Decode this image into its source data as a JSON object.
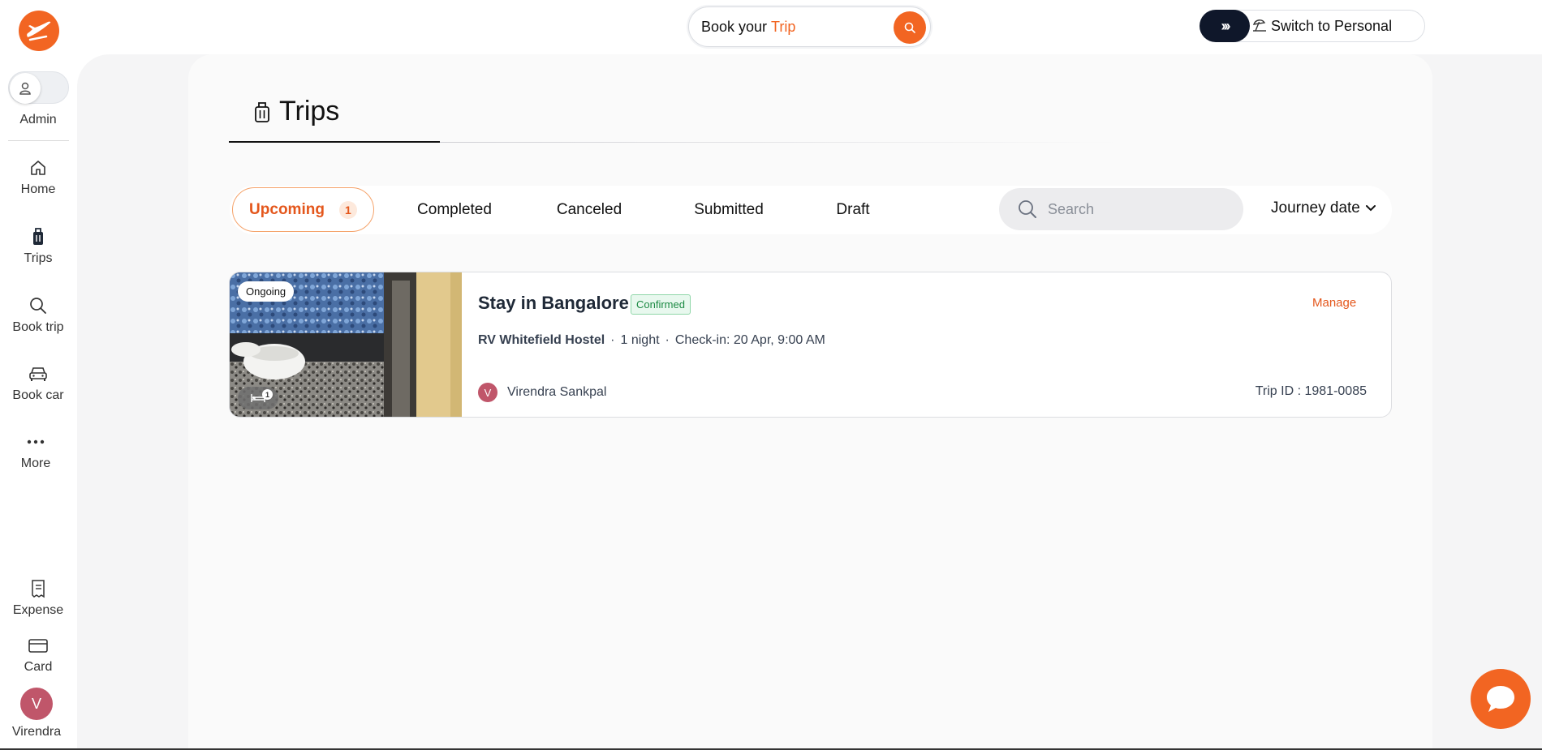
{
  "brand": {
    "accent": "#f26522"
  },
  "topbar": {
    "book_prefix": "Book your",
    "book_highlight": "Trip",
    "switch_label": "Switch to Personal"
  },
  "sidebar": {
    "role_label": "Admin",
    "items": [
      {
        "label": "Home",
        "icon": "home-icon"
      },
      {
        "label": "Trips",
        "icon": "luggage-icon"
      },
      {
        "label": "Book trip",
        "icon": "search-icon"
      },
      {
        "label": "Book car",
        "icon": "car-icon"
      },
      {
        "label": "More",
        "icon": "more-icon"
      }
    ],
    "bottom_items": [
      {
        "label": "Expense",
        "icon": "receipt-icon"
      },
      {
        "label": "Card",
        "icon": "card-icon"
      }
    ],
    "user": {
      "initial": "V",
      "name": "Virendra"
    }
  },
  "page": {
    "title": "Trips"
  },
  "tabs": [
    {
      "label": "Upcoming",
      "count": "1",
      "active": true
    },
    {
      "label": "Completed"
    },
    {
      "label": "Canceled"
    },
    {
      "label": "Submitted"
    },
    {
      "label": "Draft"
    }
  ],
  "search": {
    "placeholder": "Search"
  },
  "sort": {
    "label": "Journey date"
  },
  "trips": [
    {
      "status": "Ongoing",
      "rooms": "1",
      "title": "Stay in Bangalore",
      "badge": "Confirmed",
      "hotel": "RV Whitefield Hostel",
      "nights": "1 night",
      "checkin": "Check-in: 20 Apr, 9:00 AM",
      "traveler_initial": "V",
      "traveler": "Virendra Sankpal",
      "manage": "Manage",
      "trip_id": "Trip ID : 1981-0085"
    }
  ]
}
